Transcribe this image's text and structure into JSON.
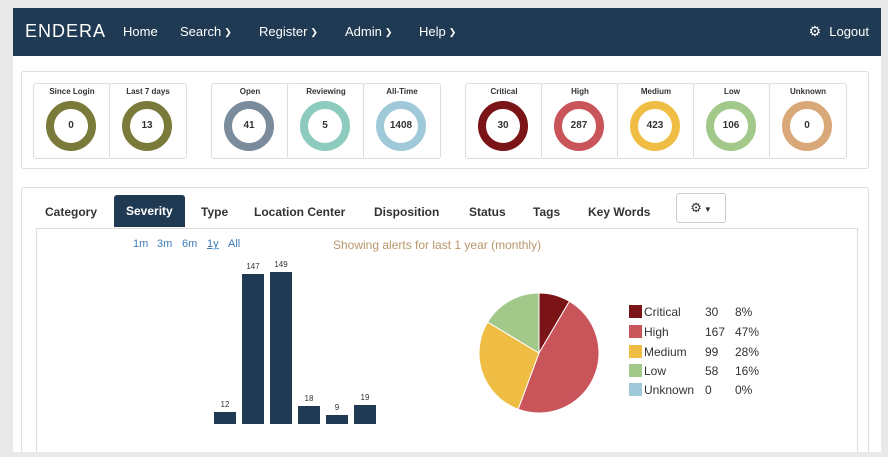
{
  "nav": {
    "brand": "ENDERA",
    "items": [
      "Home",
      "Search",
      "Register",
      "Admin",
      "Help"
    ],
    "logout": "Logout"
  },
  "counters": [
    {
      "label": "Since Login",
      "value": "0",
      "color": "#7a7a3a"
    },
    {
      "label": "Last 7 days",
      "value": "13",
      "color": "#7a7a3a"
    },
    {
      "label": "Open",
      "value": "41",
      "color": "#7a8b9b"
    },
    {
      "label": "Reviewing",
      "value": "5",
      "color": "#8ccbbd"
    },
    {
      "label": "All-Time",
      "value": "1408",
      "color": "#9fc8d8"
    },
    {
      "label": "Critical",
      "value": "30",
      "color": "#7a1416"
    },
    {
      "label": "High",
      "value": "287",
      "color": "#c9545a"
    },
    {
      "label": "Medium",
      "value": "423",
      "color": "#efbd44"
    },
    {
      "label": "Low",
      "value": "106",
      "color": "#a3c98a"
    },
    {
      "label": "Unknown",
      "value": "0",
      "color": "#d8a878"
    }
  ],
  "tabs": [
    "Category",
    "Severity",
    "Type",
    "Location Center",
    "Disposition",
    "Status",
    "Tags",
    "Key Words"
  ],
  "active_tab": "Severity",
  "ranges": [
    "1m",
    "3m",
    "6m",
    "1y",
    "All"
  ],
  "selected_range": "1y",
  "showing_text": "Showing alerts for last 1 year (monthly)",
  "chart_data": [
    {
      "type": "bar",
      "values": [
        12,
        147,
        149,
        18,
        9,
        19
      ],
      "color": "#1f3a52"
    },
    {
      "type": "pie",
      "legend": [
        {
          "name": "Critical",
          "count": "30",
          "percent": "8%",
          "color": "#7a1416"
        },
        {
          "name": "High",
          "count": "167",
          "percent": "47%",
          "color": "#c9545a"
        },
        {
          "name": "Medium",
          "count": "99",
          "percent": "28%",
          "color": "#efbd44"
        },
        {
          "name": "Low",
          "count": "58",
          "percent": "16%",
          "color": "#a3c98a"
        },
        {
          "name": "Unknown",
          "count": "0",
          "percent": "0%",
          "color": "#9fc8d8"
        }
      ]
    }
  ]
}
